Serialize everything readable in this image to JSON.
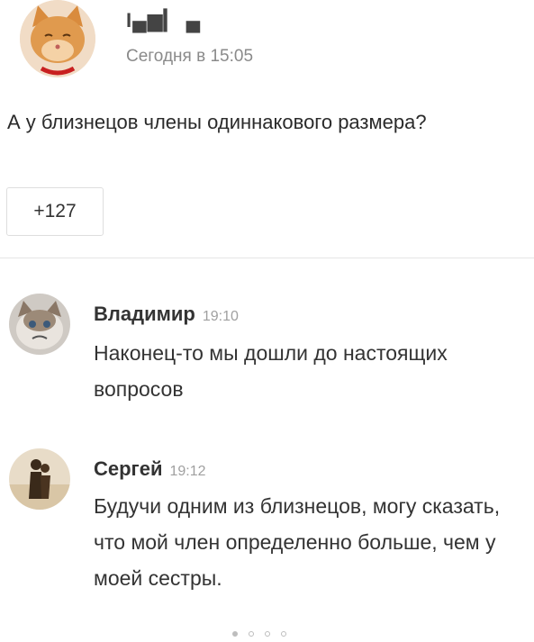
{
  "post": {
    "author": "I▄▆▎ ▄",
    "time": "Сегодня в 15:05",
    "text": "А у близнецов члены одиннакового размера?",
    "likes": "+127"
  },
  "comments": [
    {
      "author": "Владимир",
      "time": "19:10",
      "text": "Наконец-то мы дошли до настоящих вопросов",
      "avatar_icon": "grumpy-cat-avatar"
    },
    {
      "author": "Сергей",
      "time": "19:12",
      "text": "Будучи одним из близнецов, могу сказать, что мой член определенно больше, чем у моей сестры.",
      "avatar_icon": "couple-silhouette-avatar"
    }
  ],
  "pager": {
    "pages": 4,
    "active": 1
  },
  "colors": {
    "secondary_text": "#8a8a8a",
    "border": "#dedede"
  }
}
